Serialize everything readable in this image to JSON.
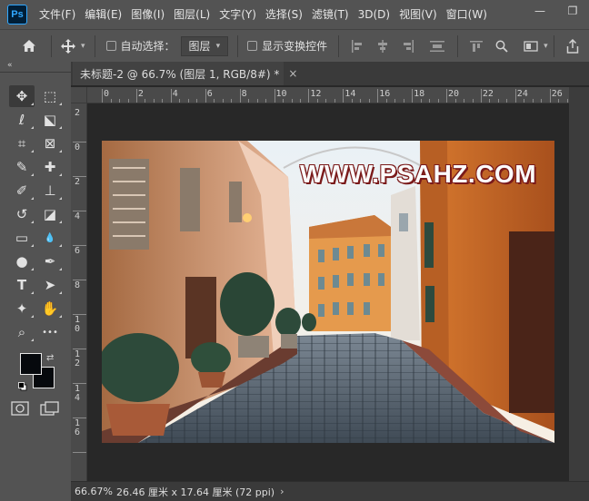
{
  "app": {
    "logo_text": "Ps",
    "menu": [
      "文件(F)",
      "编辑(E)",
      "图像(I)",
      "图层(L)",
      "文字(Y)",
      "选择(S)",
      "滤镜(T)",
      "3D(D)",
      "视图(V)",
      "窗口(W)"
    ],
    "window_controls": {
      "minimize": "—",
      "restore": "❐"
    }
  },
  "options": {
    "auto_select_label": "自动选择：",
    "auto_select_target": "图层",
    "show_transform_label": "显示变换控件"
  },
  "toolbar": {
    "collapse_glyph": "«",
    "tools": [
      {
        "name": "move-tool",
        "glyph": "✥",
        "active": true
      },
      {
        "name": "marquee-tool",
        "glyph": "⬚"
      },
      {
        "name": "lasso-tool",
        "glyph": "ℓ"
      },
      {
        "name": "object-select-tool",
        "glyph": "⬕"
      },
      {
        "name": "crop-tool",
        "glyph": "⌗"
      },
      {
        "name": "frame-tool",
        "glyph": "⊠"
      },
      {
        "name": "eyedropper-tool",
        "glyph": "✎"
      },
      {
        "name": "healing-brush-tool",
        "glyph": "✚"
      },
      {
        "name": "brush-tool",
        "glyph": "✐"
      },
      {
        "name": "clone-stamp-tool",
        "glyph": "⊥"
      },
      {
        "name": "history-brush-tool",
        "glyph": "↺"
      },
      {
        "name": "eraser-tool",
        "glyph": "◪"
      },
      {
        "name": "gradient-tool",
        "glyph": "▭"
      },
      {
        "name": "blur-tool",
        "glyph": "💧"
      },
      {
        "name": "dodge-tool",
        "glyph": "●"
      },
      {
        "name": "pen-tool",
        "glyph": "✒"
      },
      {
        "name": "type-tool",
        "glyph": "T"
      },
      {
        "name": "path-select-tool",
        "glyph": "➤"
      },
      {
        "name": "custom-shape-tool",
        "glyph": "✦"
      },
      {
        "name": "hand-tool",
        "glyph": "✋"
      },
      {
        "name": "zoom-tool",
        "glyph": "⌕"
      },
      {
        "name": "more-tools",
        "glyph": "•••"
      }
    ],
    "foreground_color": "#06090d",
    "background_color": "#06090d"
  },
  "document": {
    "tab_title": "未标题-2 @ 66.7% (图层 1, RGB/8#) *",
    "close_glyph": "×",
    "watermark": "WWW.PSAHZ.COM",
    "ruler_top": [
      "0",
      "2",
      "4",
      "6",
      "8",
      "10",
      "12",
      "14",
      "16",
      "18",
      "20",
      "22",
      "24",
      "26"
    ],
    "ruler_left": [
      "2",
      "0",
      "2",
      "4",
      "6",
      "8",
      "10",
      "12",
      "14",
      "16"
    ]
  },
  "status": {
    "zoom": "66.67%",
    "info": "26.46 厘米 x 17.64 厘米 (72 ppi)",
    "arrow": "›"
  }
}
